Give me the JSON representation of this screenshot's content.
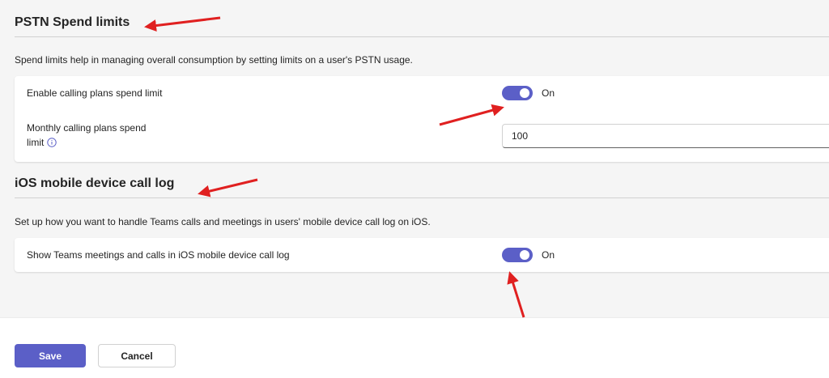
{
  "pstn": {
    "title": "PSTN Spend limits",
    "description": "Spend limits help in managing overall consumption by setting limits on a user's PSTN usage.",
    "enable_label": "Enable calling plans spend limit",
    "enable_state": "On",
    "monthly_label_line1": "Monthly calling plans spend",
    "monthly_label_line2": "limit",
    "monthly_value": "100"
  },
  "ios": {
    "title": "iOS mobile device call log",
    "description": "Set up how you want to handle Teams calls and meetings in users' mobile device call log on iOS.",
    "show_label": "Show Teams meetings and calls in iOS mobile device call log",
    "show_state": "On"
  },
  "footer": {
    "save_label": "Save",
    "cancel_label": "Cancel"
  },
  "colors": {
    "accent": "#5b5fc7",
    "annotation": "#e02020"
  },
  "icons": {
    "info": "info-icon",
    "annotation_arrow": "red-arrow-icon"
  }
}
